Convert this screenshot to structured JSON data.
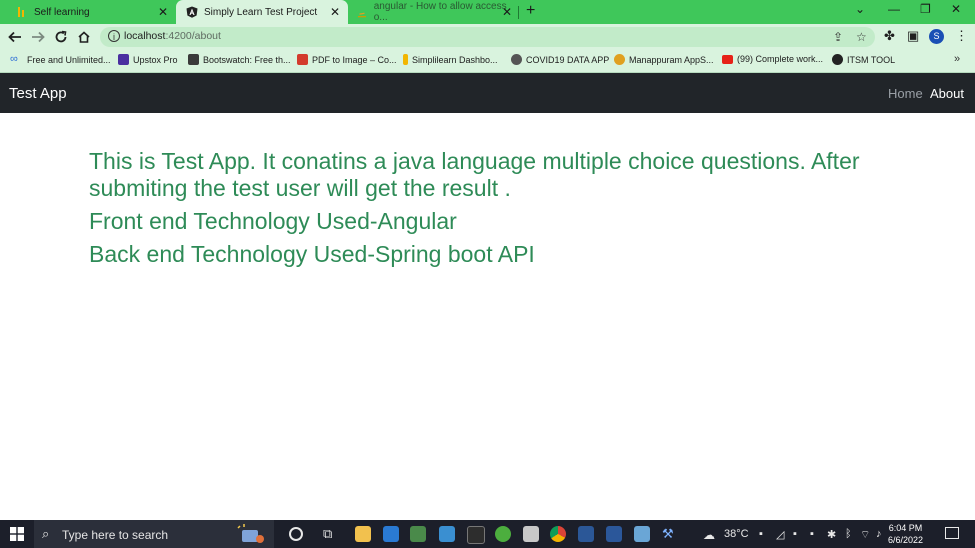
{
  "browser": {
    "tabs": [
      {
        "title": "Self learning",
        "active": false
      },
      {
        "title": "Simply Learn Test Project",
        "active": true
      },
      {
        "title": "angular - How to allow access o...",
        "active": false
      }
    ],
    "url": {
      "host": "localhost",
      "path": ":4200/about"
    },
    "profile_initial": "S",
    "accent_color": "#3fc75a"
  },
  "bookmarks": [
    {
      "label": "Free and Unlimited...",
      "icon": "infinity-icon",
      "color": "#2f6fd6"
    },
    {
      "label": "Upstox Pro",
      "icon": "upstox-icon",
      "color": "#4a2fa0"
    },
    {
      "label": "Bootswatch: Free th...",
      "icon": "bootswatch-icon",
      "color": "#3a3a3a"
    },
    {
      "label": "PDF to Image – Co...",
      "icon": "pdf-icon",
      "color": "#d33b2c"
    },
    {
      "label": "Simplilearn Dashbo...",
      "icon": "simplilearn-icon",
      "color": "#f2b600"
    },
    {
      "label": "COVID19 DATA APP",
      "icon": "covid-icon",
      "color": "#555555"
    },
    {
      "label": "Manappuram AppS...",
      "icon": "manappuram-icon",
      "color": "#e0a020"
    },
    {
      "label": "(99) Complete work...",
      "icon": "youtube-icon",
      "color": "#e62117"
    },
    {
      "label": "ITSM TOOL",
      "icon": "itsm-icon",
      "color": "#222222"
    }
  ],
  "app": {
    "brand": "Test App",
    "nav": {
      "home": "Home",
      "about": "About"
    },
    "content": {
      "paragraph1": "This is Test App. It conatins a java language multiple choice questions. After submiting the test user will get the result .",
      "paragraph2": "Front end Technology Used-Angular",
      "paragraph3": "Back end Technology Used-Spring boot API"
    },
    "text_color": "#2e8b57",
    "navbar_color": "#212529"
  },
  "taskbar": {
    "search_placeholder": "Type here to search",
    "temperature": "38°C",
    "time": "6:04 PM",
    "date": "6/6/2022"
  }
}
